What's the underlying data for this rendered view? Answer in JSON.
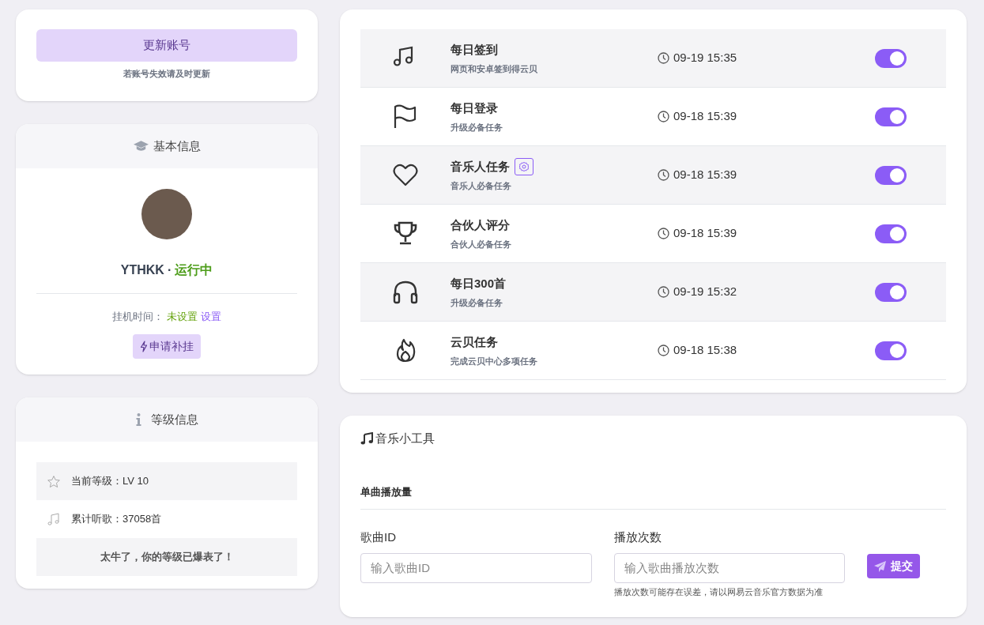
{
  "account": {
    "update_button": "更新账号",
    "hint": "若账号失效请及时更新"
  },
  "basic_info": {
    "title": "基本信息",
    "username": "YTHKK",
    "separator": "·",
    "status": "运行中",
    "hang_label": "挂机时间：",
    "hang_value": "未设置",
    "hang_link": "设置",
    "apply_button": "申请补挂"
  },
  "level_info": {
    "title": "等级信息",
    "rows": [
      {
        "kind": "star",
        "text": "当前等级：LV 10"
      },
      {
        "kind": "music",
        "text": "累计听歌：37058首"
      }
    ],
    "message": "太牛了，你的等级已爆表了！"
  },
  "tasks": [
    {
      "kind": "music",
      "title": "每日签到",
      "subtitle": "网页和安卓签到得云贝",
      "time": "09-19 15:35",
      "on": true,
      "settings": false
    },
    {
      "kind": "flag",
      "title": "每日登录",
      "subtitle": "升级必备任务",
      "time": "09-18 15:39",
      "on": true,
      "settings": false
    },
    {
      "kind": "heart",
      "title": "音乐人任务",
      "subtitle": "音乐人必备任务",
      "time": "09-18 15:39",
      "on": true,
      "settings": true
    },
    {
      "kind": "trophy",
      "title": "合伙人评分",
      "subtitle": "合伙人必备任务",
      "time": "09-18 15:39",
      "on": true,
      "settings": false
    },
    {
      "kind": "headphones",
      "title": "每日300首",
      "subtitle": "升级必备任务",
      "time": "09-19 15:32",
      "on": true,
      "settings": false
    },
    {
      "kind": "fire",
      "title": "云贝任务",
      "subtitle": "完成云贝中心多项任务",
      "time": "09-18 15:38",
      "on": true,
      "settings": false
    }
  ],
  "tools": {
    "title": "音乐小工具",
    "section": "单曲播放量",
    "fields": [
      {
        "label": "歌曲ID",
        "placeholder": "输入歌曲ID"
      },
      {
        "label": "播放次数",
        "placeholder": "输入歌曲播放次数",
        "hint": "播放次数可能存在误差，请以网易云音乐官方数据为准"
      }
    ],
    "submit": "提交"
  }
}
